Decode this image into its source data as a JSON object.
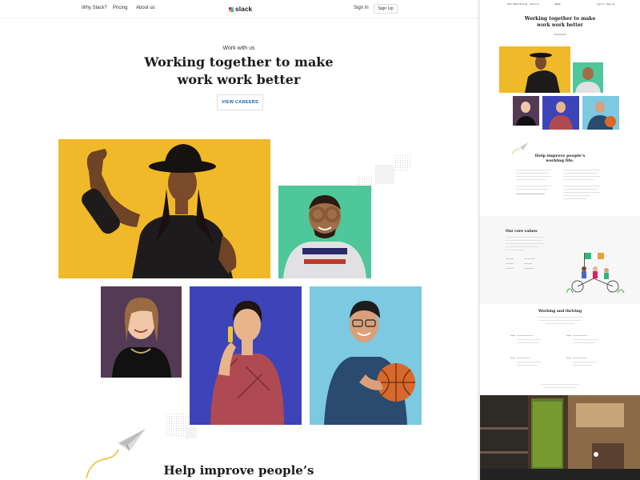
{
  "nav": {
    "links": [
      "Why Slack?",
      "Pricing",
      "About us"
    ],
    "logo_text": "slack",
    "sign_in": "Sign In",
    "sign_up": "Sign Up"
  },
  "hero": {
    "eyebrow": "Work with us",
    "title_line1": "Working together to make",
    "title_line2": "work work better",
    "cta": "VIEW CAREERS"
  },
  "section2": {
    "title": "Help improve people’s"
  },
  "thumbnail": {
    "nav_links": [
      "Why Slack?",
      "Pricing",
      "About us"
    ],
    "logo_text": "slack",
    "sign_in": "Sign In",
    "sign_up": "Sign Up",
    "hero_title_line1": "Working together to make",
    "hero_title_line2": "work work better",
    "help_title_line1": "Help improve people’s",
    "help_title_line2": "working life.",
    "values_title": "Our core values",
    "thriving_title": "Working and thriving"
  },
  "colors": {
    "yellow": "#f0b929",
    "green": "#4ec79a",
    "plum": "#533a55",
    "blue": "#3d44b8",
    "sky": "#7cc9e1",
    "link_blue": "#1264a3"
  },
  "icons": [
    "paper-plane-icon",
    "slack-logo-icon"
  ]
}
